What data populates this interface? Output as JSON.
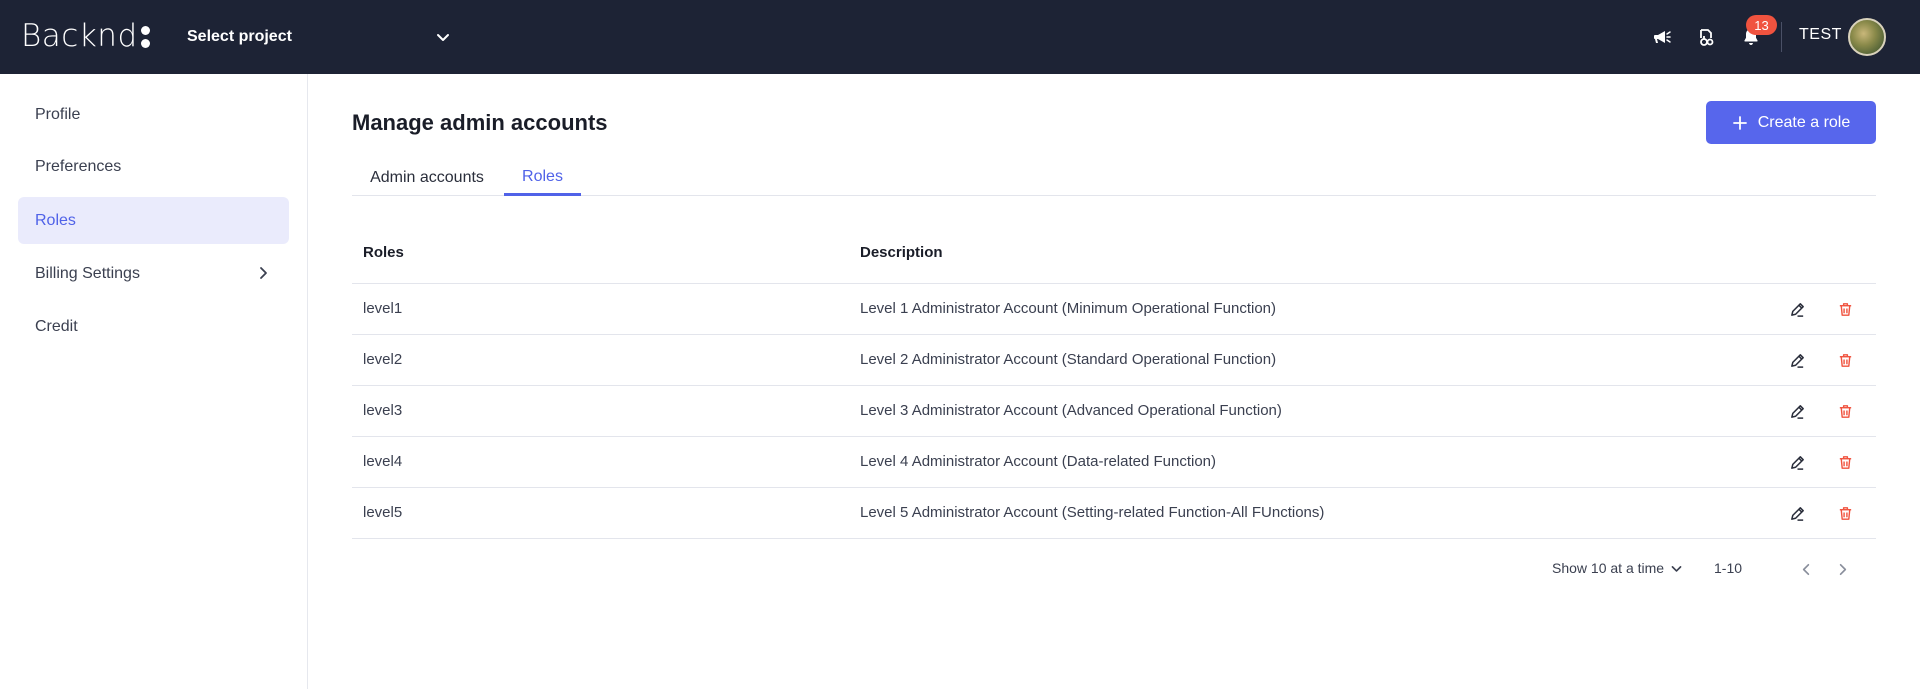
{
  "header": {
    "logo_text": "Backnd",
    "project_select": "Select project",
    "notification_count": "13",
    "user_name": "TEST"
  },
  "sidebar": {
    "items": [
      {
        "label": "Profile"
      },
      {
        "label": "Preferences"
      },
      {
        "label": "Roles"
      },
      {
        "label": "Billing Settings"
      },
      {
        "label": "Credit"
      }
    ]
  },
  "main": {
    "title": "Manage admin accounts",
    "create_button": "Create a role",
    "tabs": [
      {
        "label": "Admin accounts"
      },
      {
        "label": "Roles"
      }
    ],
    "table": {
      "columns": [
        "Roles",
        "Description"
      ],
      "rows": [
        {
          "role": "level1",
          "description": "Level 1 Administrator Account (Minimum Operational Function)"
        },
        {
          "role": "level2",
          "description": "Level 2 Administrator Account (Standard Operational Function)"
        },
        {
          "role": "level3",
          "description": "Level 3 Administrator Account (Advanced Operational Function)"
        },
        {
          "role": "level4",
          "description": "Level 4 Administrator Account (Data-related Function)"
        },
        {
          "role": "level5",
          "description": "Level 5 Administrator Account (Setting-related Function-All FUnctions)"
        }
      ]
    },
    "pagination": {
      "page_size": "Show 10 at a time",
      "range": "1-10"
    }
  },
  "colors": {
    "topbar": "#1d2335",
    "accent": "#5766ec",
    "active_bg": "#eaebfc",
    "badge": "#f0533f",
    "delete": "#f0533f"
  },
  "icons": {
    "megaphone": "megaphone-icon",
    "support": "support-icon",
    "bell": "bell-icon",
    "edit": "pencil-icon",
    "delete": "trash-icon"
  }
}
